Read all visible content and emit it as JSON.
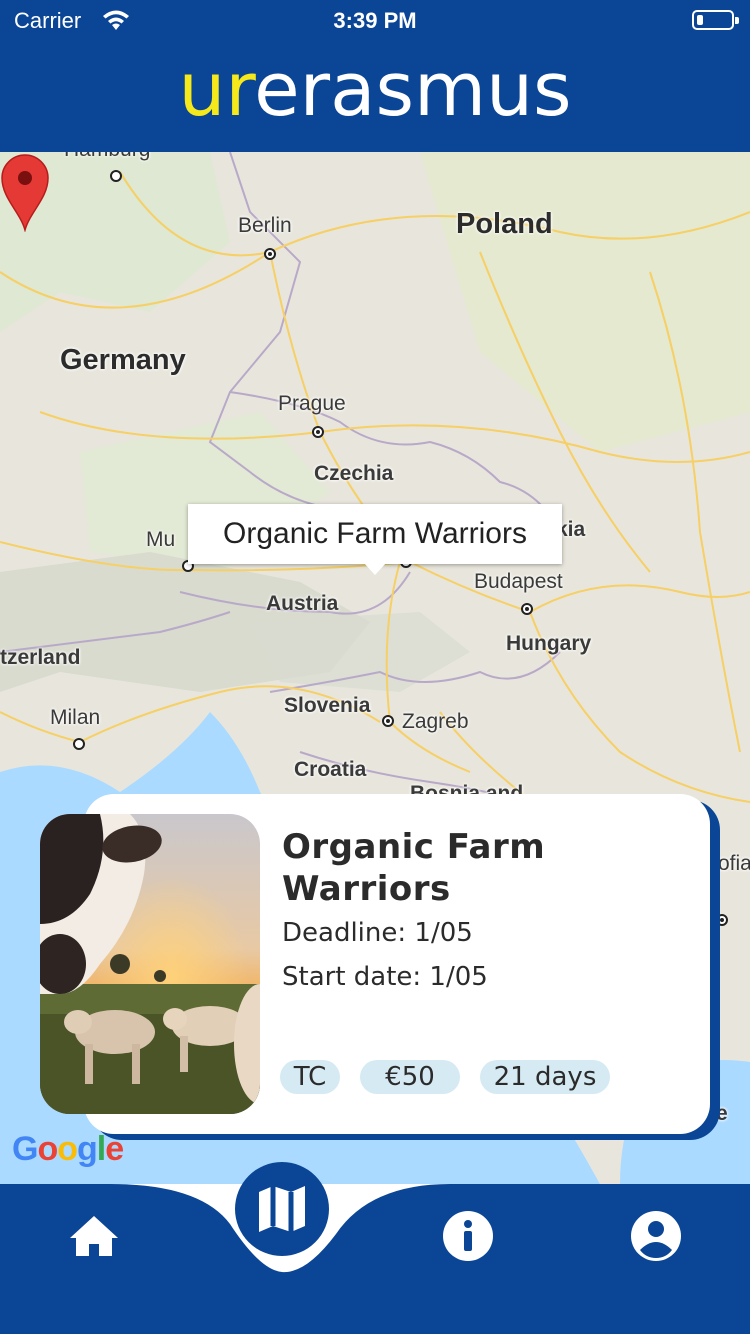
{
  "status_bar": {
    "carrier": "Carrier",
    "time": "3:39 PM"
  },
  "header": {
    "logo_prefix": "ur",
    "logo_suffix": "erasmus",
    "logo_prefix_color": "#f5e81b",
    "background_color": "#0b4596"
  },
  "map": {
    "country_labels": [
      "Germany",
      "Poland",
      "Austria",
      "Hungary"
    ],
    "region_labels": [
      "Czechia",
      "Slovenia",
      "Croatia"
    ],
    "city_labels": [
      "Hamburg",
      "Berlin",
      "Prague",
      "Budapest",
      "Zagreb",
      "Milan",
      "Mu"
    ],
    "partial_labels": [
      "tzerland",
      "kia",
      "Bosnia and",
      "ofia",
      "e"
    ],
    "info_window_title": "Organic Farm Warriors",
    "marker_color": "#e53935",
    "attribution": "Google"
  },
  "card": {
    "title": "Organic Farm Warriors",
    "deadline": "Deadline: 1/05",
    "start_date": "Start date: 1/05",
    "chips": [
      "TC",
      "€50",
      "21 days"
    ]
  },
  "tab_bar": {
    "items": [
      {
        "name": "home",
        "icon": "home-icon"
      },
      {
        "name": "map",
        "icon": "map-icon",
        "active": true
      },
      {
        "name": "info",
        "icon": "info-icon"
      },
      {
        "name": "profile",
        "icon": "profile-icon"
      }
    ]
  }
}
